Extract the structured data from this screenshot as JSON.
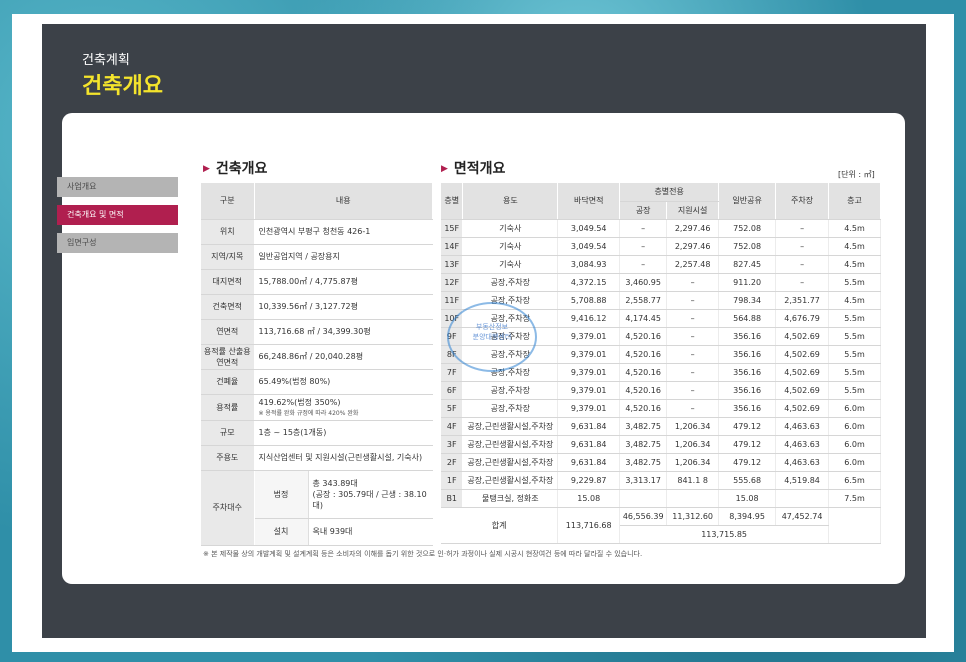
{
  "header": {
    "subtitle": "건축계획",
    "title": "건축개요"
  },
  "sidebar": {
    "items": [
      {
        "label": "사업개요"
      },
      {
        "label": "건축개요 및 면적"
      },
      {
        "label": "입면구성"
      }
    ]
  },
  "overview": {
    "title": "건축개요",
    "col_label": "구분",
    "col_value": "내용",
    "rows": [
      {
        "label": "위치",
        "value": "인천광역시 부평구 청천동 426-1"
      },
      {
        "label": "지역/지목",
        "value": "일반공업지역 / 공장용지"
      },
      {
        "label": "대지면적",
        "value": "15,788.00㎡ / 4,775.87평"
      },
      {
        "label": "건축면적",
        "value": "10,339.56㎡ /  3,127.72평"
      },
      {
        "label": "연면적",
        "value": "113,716.68 ㎡ /  34,399.30평"
      },
      {
        "label": "용적률 산출용 연면적",
        "value": "66,248.86㎡ /  20,040.28평"
      },
      {
        "label": "건폐율",
        "value": "65.49%(법정 80%)"
      },
      {
        "label": "용적률",
        "value": "419.62%(법정 350%)",
        "sub": "※ 용적률 완화 규정에 따라 420% 완화"
      },
      {
        "label": "규모",
        "value": "1층 ~ 15층(1개동)"
      },
      {
        "label": "주용도",
        "value": "지식산업센터 및 지원시설(근린생활시설, 기숙사)"
      }
    ],
    "parking": {
      "label": "주차대수",
      "legal_label": "법정",
      "legal_line1": "총 343.89대",
      "legal_line2": "(공장 : 305.79대 / 근생 : 38.10대)",
      "install_label": "설치",
      "install_value": "옥내 939대"
    }
  },
  "area": {
    "title": "면적개요",
    "unit": "[단위 : ㎡]",
    "headers": {
      "floor": "층별",
      "use": "용도",
      "floor_area": "바닥면적",
      "exclusive": "층별전용",
      "factory": "공장",
      "support": "지원시설",
      "common": "일반공유",
      "parking": "주차장",
      "height": "층고"
    },
    "rows": [
      {
        "f": "15F",
        "u": "기숙사",
        "a": "3,049.54",
        "fa": "–",
        "s": "2,297.46",
        "c": "752.08",
        "p": "–",
        "h": "4.5m"
      },
      {
        "f": "14F",
        "u": "기숙사",
        "a": "3,049.54",
        "fa": "–",
        "s": "2,297.46",
        "c": "752.08",
        "p": "–",
        "h": "4.5m"
      },
      {
        "f": "13F",
        "u": "기숙사",
        "a": "3,084.93",
        "fa": "–",
        "s": "2,257.48",
        "c": "827.45",
        "p": "–",
        "h": "4.5m"
      },
      {
        "f": "12F",
        "u": "공장,주차장",
        "a": "4,372.15",
        "fa": "3,460.95",
        "s": "–",
        "c": "911.20",
        "p": "–",
        "h": "5.5m"
      },
      {
        "f": "11F",
        "u": "공장,주차장",
        "a": "5,708.88",
        "fa": "2,558.77",
        "s": "–",
        "c": "798.34",
        "p": "2,351.77",
        "h": "4.5m"
      },
      {
        "f": "10F",
        "u": "공장,주차장",
        "a": "9,416.12",
        "fa": "4,174.45",
        "s": "–",
        "c": "564.88",
        "p": "4,676.79",
        "h": "5.5m"
      },
      {
        "f": "9F",
        "u": "공장,주차장",
        "a": "9,379.01",
        "fa": "4,520.16",
        "s": "–",
        "c": "356.16",
        "p": "4,502.69",
        "h": "5.5m"
      },
      {
        "f": "8F",
        "u": "공장,주차장",
        "a": "9,379.01",
        "fa": "4,520.16",
        "s": "–",
        "c": "356.16",
        "p": "4,502.69",
        "h": "5.5m"
      },
      {
        "f": "7F",
        "u": "공장,주차장",
        "a": "9,379.01",
        "fa": "4,520.16",
        "s": "–",
        "c": "356.16",
        "p": "4,502.69",
        "h": "5.5m"
      },
      {
        "f": "6F",
        "u": "공장,주차장",
        "a": "9,379.01",
        "fa": "4,520.16",
        "s": "–",
        "c": "356.16",
        "p": "4,502.69",
        "h": "5.5m"
      },
      {
        "f": "5F",
        "u": "공장,주차장",
        "a": "9,379.01",
        "fa": "4,520.16",
        "s": "–",
        "c": "356.16",
        "p": "4,502.69",
        "h": "6.0m"
      },
      {
        "f": "4F",
        "u": "공장,근린생활시설,주차장",
        "a": "9,631.84",
        "fa": "3,482.75",
        "s": "1,206.34",
        "c": "479.12",
        "p": "4,463.63",
        "h": "6.0m"
      },
      {
        "f": "3F",
        "u": "공장,근린생활시설,주차장",
        "a": "9,631.84",
        "fa": "3,482.75",
        "s": "1,206.34",
        "c": "479.12",
        "p": "4,463.63",
        "h": "6.0m"
      },
      {
        "f": "2F",
        "u": "공장,근린생활시설,주차장",
        "a": "9,631.84",
        "fa": "3,482.75",
        "s": "1,206.34",
        "c": "479.12",
        "p": "4,463.63",
        "h": "6.0m"
      },
      {
        "f": "1F",
        "u": "공장,근린생활시설,주차장",
        "a": "9,229.87",
        "fa": "3,313.17",
        "s": "841.1 8",
        "c": "555.68",
        "p": "4,519.84",
        "h": "6.5m"
      },
      {
        "f": "B1",
        "u": "물탱크실, 정화조",
        "a": "15.08",
        "fa": "",
        "s": "",
        "c": "15.08",
        "p": "",
        "h": "7.5m"
      }
    ],
    "total": {
      "label": "합계",
      "area": "113,716.68",
      "factory": "46,556.39",
      "support": "11,312.60",
      "common": "8,394.95",
      "parking": "47,452.74",
      "sum": "113,715.85"
    }
  },
  "footnote": "※ 본 제작물 상의 개발계획 및 설계계획 등은 소비자의 이해를 돕기 위한 것으로 인·허가 과정이나 실제 시공시 현장여건 등에 따라 달라질 수 있습니다.",
  "stamp": {
    "line1": "부동산정보",
    "line2": "분양대행센터"
  },
  "colors": {
    "accent": "#b01f4f",
    "headline": "#f4e42c",
    "panel": "#3c4148"
  }
}
